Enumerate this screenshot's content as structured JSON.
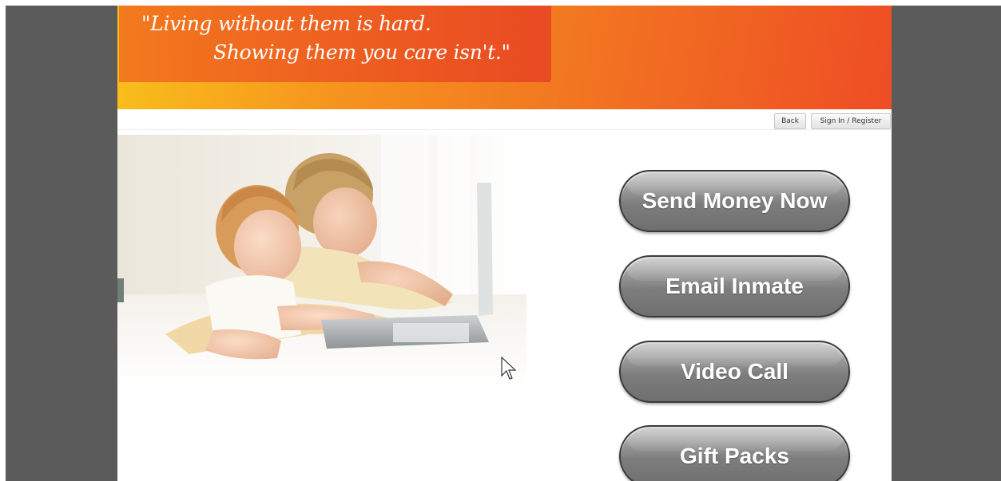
{
  "banner": {
    "quote_line1": "\"Living without them is hard.",
    "quote_line2": "Showing them you care isn't.\""
  },
  "nav": {
    "back_label": "Back",
    "signin_label": "Sign In / Register"
  },
  "actions": [
    {
      "label": "Send Money Now"
    },
    {
      "label": "Email Inmate"
    },
    {
      "label": "Video Call"
    },
    {
      "label": "Gift Packs"
    }
  ],
  "colors": {
    "frame": "#5b5b5c",
    "banner_start": "#f9c01c",
    "banner_end": "#ee4d24",
    "button_gray": "#8a8a8a"
  },
  "icons": {
    "cursor": "mouse-pointer-icon"
  }
}
